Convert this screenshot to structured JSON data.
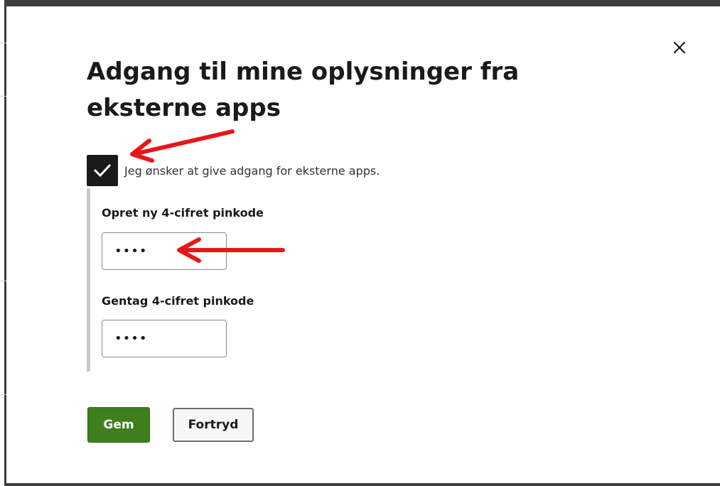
{
  "dialog": {
    "title": "Adgang til mine oplysninger fra eksterne apps",
    "close_label": "×"
  },
  "consent": {
    "checked": true,
    "label": "Jeg ønsker at give adgang for eksterne apps."
  },
  "pin_fields": [
    {
      "label": "Opret ny 4-cifret pinkode",
      "value": "••••"
    },
    {
      "label": "Gentag 4-cifret pinkode",
      "value": "••••"
    }
  ],
  "actions": {
    "save_label": "Gem",
    "cancel_label": "Fortryd"
  },
  "colors": {
    "primary_button": "#3f7f1d",
    "checkbox_fill": "#1a1a1a",
    "annotation_arrow": "#e8161a",
    "indent_bar": "#c9c9c9"
  },
  "icons": {
    "close": "close-icon",
    "check": "checkmark-icon",
    "arrow": "arrow-left-icon"
  }
}
